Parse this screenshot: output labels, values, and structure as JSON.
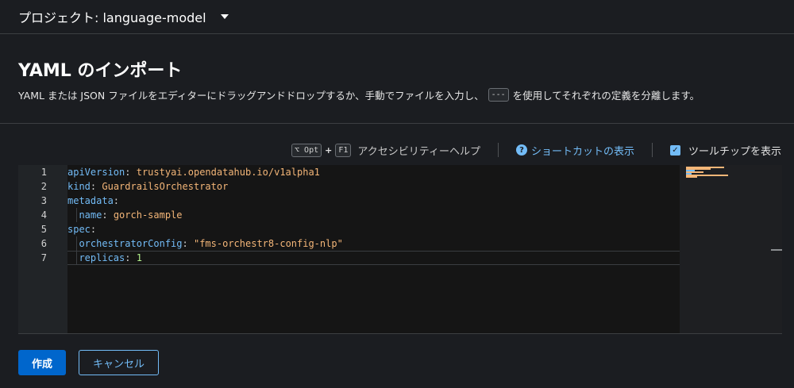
{
  "project_bar": {
    "label": "プロジェクト: language-model"
  },
  "heading": "YAML のインポート",
  "description": {
    "before": "YAML または JSON ファイルをエディターにドラッグアンドドロップするか、手動でファイルを入力し、",
    "separator_code": "---",
    "after": "を使用してそれぞれの定義を分離します。"
  },
  "toolbar": {
    "key_opt": "⌥ Opt",
    "key_plus": "+",
    "key_f1": "F1",
    "accessibility_help": "アクセシビリティーヘルプ",
    "shortcuts_link": "ショートカットの表示",
    "tooltips_label": "ツールチップを表示",
    "tooltips_checked": true
  },
  "editor": {
    "line_numbers": [
      "1",
      "2",
      "3",
      "4",
      "5",
      "6",
      "7"
    ],
    "lines": [
      {
        "indent": "",
        "key": "apiVersion",
        "value": "trustyai.opendatahub.io/v1alpha1",
        "type": "string"
      },
      {
        "indent": "",
        "key": "kind",
        "value": "GuardrailsOrchestrator",
        "type": "string"
      },
      {
        "indent": "",
        "key": "metadata",
        "value": "",
        "type": "none"
      },
      {
        "indent": "  ",
        "key": "name",
        "value": "gorch-sample",
        "type": "string"
      },
      {
        "indent": "",
        "key": "spec",
        "value": "",
        "type": "none"
      },
      {
        "indent": "  ",
        "key": "orchestratorConfig",
        "value": "\"fms-orchestr8-config-nlp\"",
        "type": "string"
      },
      {
        "indent": "  ",
        "key": "replicas",
        "value": "1",
        "type": "number"
      }
    ]
  },
  "actions": {
    "create": "作成",
    "cancel": "キャンセル"
  },
  "colors": {
    "accent": "#73bcf7",
    "primary_button": "#0066cc",
    "yaml_key": "#73bcf7",
    "yaml_string": "#f4b678",
    "yaml_number": "#b2f08a"
  }
}
